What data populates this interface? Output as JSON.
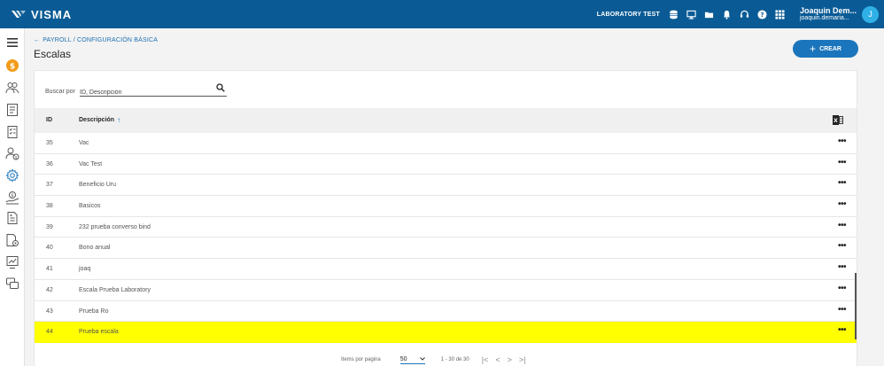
{
  "header": {
    "logo_text": "VISMA",
    "company": "LABORATORY TEST",
    "user_name": "Joaquin Dem...",
    "user_email": "joaquin.demaria...",
    "avatar_initial": "J"
  },
  "breadcrumb": {
    "back_glyph": "←",
    "path": "PAYROLL / CONFIGURACIÓN BÁSICA"
  },
  "page": {
    "title": "Escalas",
    "create_label": "CREAR",
    "create_glyph": "+"
  },
  "search": {
    "label": "Buscar por",
    "placeholder": "ID, Descripción"
  },
  "table": {
    "col_id": "ID",
    "col_desc": "Descripción",
    "sort_glyph": "↑",
    "more_glyph": "•••",
    "rows": [
      {
        "id": "35",
        "desc": "Vac"
      },
      {
        "id": "36",
        "desc": "Vac Test"
      },
      {
        "id": "37",
        "desc": "Beneficio Uru"
      },
      {
        "id": "38",
        "desc": "Basicos"
      },
      {
        "id": "39",
        "desc": "232 prueba converso bind"
      },
      {
        "id": "40",
        "desc": "Bono anual"
      },
      {
        "id": "41",
        "desc": "joaq"
      },
      {
        "id": "42",
        "desc": "Escala Prueba Laboratory"
      },
      {
        "id": "43",
        "desc": "Prueba Ro"
      },
      {
        "id": "44",
        "desc": "Prueba escala"
      }
    ]
  },
  "pager": {
    "items_label": "Items por pagina",
    "page_size": "50",
    "range": "1 - 30 de 30",
    "first_glyph": "|<",
    "prev_glyph": "<",
    "next_glyph": ">",
    "last_glyph": ">|"
  },
  "colors": {
    "topbar": "#0a5b95",
    "accent": "#1b75bc",
    "highlight": "#ffff00",
    "avatar": "#2fb0e6",
    "coin": "#f29b18"
  }
}
